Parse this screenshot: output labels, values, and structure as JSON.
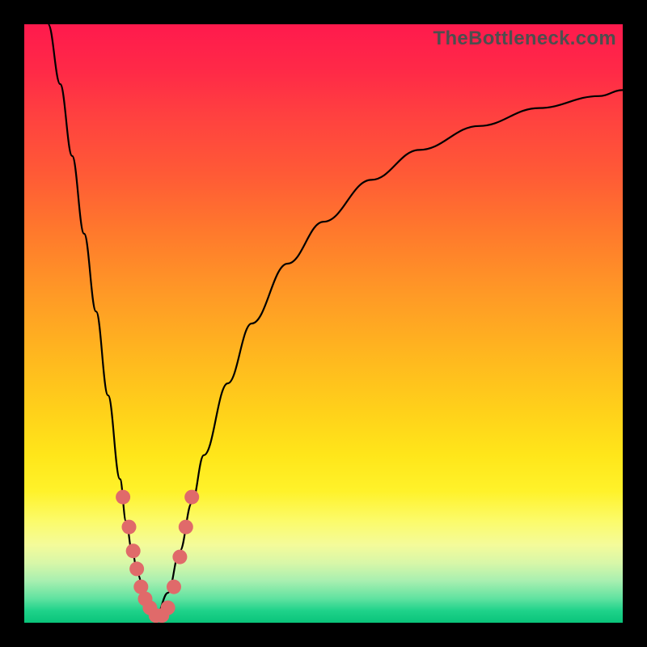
{
  "watermark": "TheBottleneck.com",
  "colors": {
    "frame": "#000000",
    "curve": "#000000",
    "marker": "#e06a6a",
    "gradient_top": "#ff1a4d",
    "gradient_bottom": "#0ac47a"
  },
  "chart_data": {
    "type": "line",
    "title": "",
    "xlabel": "",
    "ylabel": "",
    "xlim": [
      0,
      100
    ],
    "ylim": [
      0,
      100
    ],
    "axes_visible": false,
    "grid": false,
    "legend": false,
    "background": "rainbow-gradient (red top → green bottom)",
    "series": [
      {
        "name": "left-branch",
        "description": "steep descending curve from top-left to valley",
        "x": [
          4,
          6,
          8,
          10,
          12,
          14,
          16,
          17,
          18,
          19,
          20,
          21,
          22
        ],
        "y": [
          100,
          90,
          78,
          65,
          52,
          38,
          24,
          17,
          12,
          8,
          5,
          3,
          1
        ]
      },
      {
        "name": "right-branch",
        "description": "rising curve from valley toward upper-right, flattening",
        "x": [
          22,
          24,
          26,
          28,
          30,
          34,
          38,
          44,
          50,
          58,
          66,
          76,
          86,
          96,
          100
        ],
        "y": [
          1,
          5,
          12,
          20,
          28,
          40,
          50,
          60,
          67,
          74,
          79,
          83,
          86,
          88,
          89
        ]
      }
    ],
    "markers": {
      "name": "highlighted-points",
      "color": "#e06a6a",
      "radius_approx": 1.2,
      "points": [
        {
          "x": 16.5,
          "y": 21
        },
        {
          "x": 17.5,
          "y": 16
        },
        {
          "x": 18.2,
          "y": 12
        },
        {
          "x": 18.8,
          "y": 9
        },
        {
          "x": 19.5,
          "y": 6
        },
        {
          "x": 20.2,
          "y": 4
        },
        {
          "x": 21.0,
          "y": 2.5
        },
        {
          "x": 22.0,
          "y": 1.2
        },
        {
          "x": 23.0,
          "y": 1.2
        },
        {
          "x": 24.0,
          "y": 2.5
        },
        {
          "x": 25.0,
          "y": 6
        },
        {
          "x": 26.0,
          "y": 11
        },
        {
          "x": 27.0,
          "y": 16
        },
        {
          "x": 28.0,
          "y": 21
        }
      ]
    },
    "valley_x_approx": 22,
    "notes": "Values are approximate, read by eye from an unlabeled plot. x and y are expressed as percent of plot width/height (0 = left/bottom, 100 = right/top)."
  }
}
